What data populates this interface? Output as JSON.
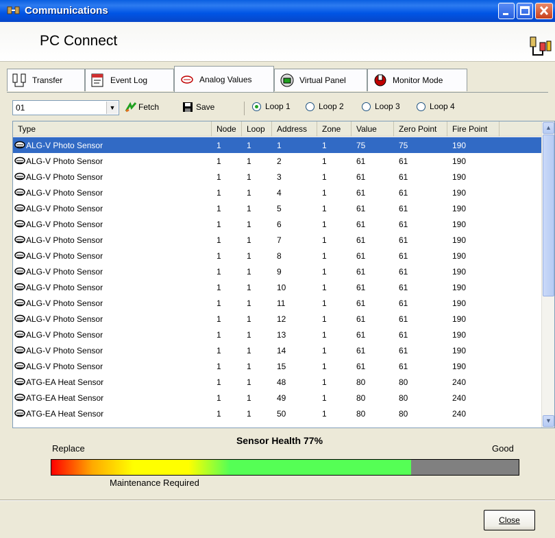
{
  "window": {
    "title": "Communications"
  },
  "header": {
    "title": "PC Connect"
  },
  "tabs": [
    {
      "label": "Transfer",
      "icon": "transfer-icon"
    },
    {
      "label": "Event Log",
      "icon": "event-log-icon"
    },
    {
      "label": "Analog Values",
      "icon": "sensor-icon"
    },
    {
      "label": "Virtual Panel",
      "icon": "virtual-panel-icon"
    },
    {
      "label": "Monitor Mode",
      "icon": "monitor-icon"
    }
  ],
  "toolbar": {
    "combo_value": "01",
    "fetch_label": "Fetch",
    "save_label": "Save",
    "loops": [
      "Loop 1",
      "Loop 2",
      "Loop 3",
      "Loop 4"
    ],
    "selected_loop": "Loop 1"
  },
  "table": {
    "columns": [
      "Type",
      "Node",
      "Loop",
      "Address",
      "Zone",
      "Value",
      "Zero Point",
      "Fire Point"
    ],
    "rows": [
      [
        "ALG-V Photo Sensor",
        "1",
        "1",
        "1",
        "1",
        "75",
        "75",
        "190"
      ],
      [
        "ALG-V Photo Sensor",
        "1",
        "1",
        "2",
        "1",
        "61",
        "61",
        "190"
      ],
      [
        "ALG-V Photo Sensor",
        "1",
        "1",
        "3",
        "1",
        "61",
        "61",
        "190"
      ],
      [
        "ALG-V Photo Sensor",
        "1",
        "1",
        "4",
        "1",
        "61",
        "61",
        "190"
      ],
      [
        "ALG-V Photo Sensor",
        "1",
        "1",
        "5",
        "1",
        "61",
        "61",
        "190"
      ],
      [
        "ALG-V Photo Sensor",
        "1",
        "1",
        "6",
        "1",
        "61",
        "61",
        "190"
      ],
      [
        "ALG-V Photo Sensor",
        "1",
        "1",
        "7",
        "1",
        "61",
        "61",
        "190"
      ],
      [
        "ALG-V Photo Sensor",
        "1",
        "1",
        "8",
        "1",
        "61",
        "61",
        "190"
      ],
      [
        "ALG-V Photo Sensor",
        "1",
        "1",
        "9",
        "1",
        "61",
        "61",
        "190"
      ],
      [
        "ALG-V Photo Sensor",
        "1",
        "1",
        "10",
        "1",
        "61",
        "61",
        "190"
      ],
      [
        "ALG-V Photo Sensor",
        "1",
        "1",
        "11",
        "1",
        "61",
        "61",
        "190"
      ],
      [
        "ALG-V Photo Sensor",
        "1",
        "1",
        "12",
        "1",
        "61",
        "61",
        "190"
      ],
      [
        "ALG-V Photo Sensor",
        "1",
        "1",
        "13",
        "1",
        "61",
        "61",
        "190"
      ],
      [
        "ALG-V Photo Sensor",
        "1",
        "1",
        "14",
        "1",
        "61",
        "61",
        "190"
      ],
      [
        "ALG-V Photo Sensor",
        "1",
        "1",
        "15",
        "1",
        "61",
        "61",
        "190"
      ],
      [
        "ATG-EA Heat Sensor",
        "1",
        "1",
        "48",
        "1",
        "80",
        "80",
        "240"
      ],
      [
        "ATG-EA Heat Sensor",
        "1",
        "1",
        "49",
        "1",
        "80",
        "80",
        "240"
      ],
      [
        "ATG-EA Heat Sensor",
        "1",
        "1",
        "50",
        "1",
        "80",
        "80",
        "240"
      ]
    ],
    "selected_row": 0
  },
  "health": {
    "title": "Sensor Health 77%",
    "level": 0.77,
    "left_label": "Replace",
    "right_label": "Good",
    "bottom_label": "Maintenance Required"
  },
  "footer": {
    "close_label": "Close"
  }
}
